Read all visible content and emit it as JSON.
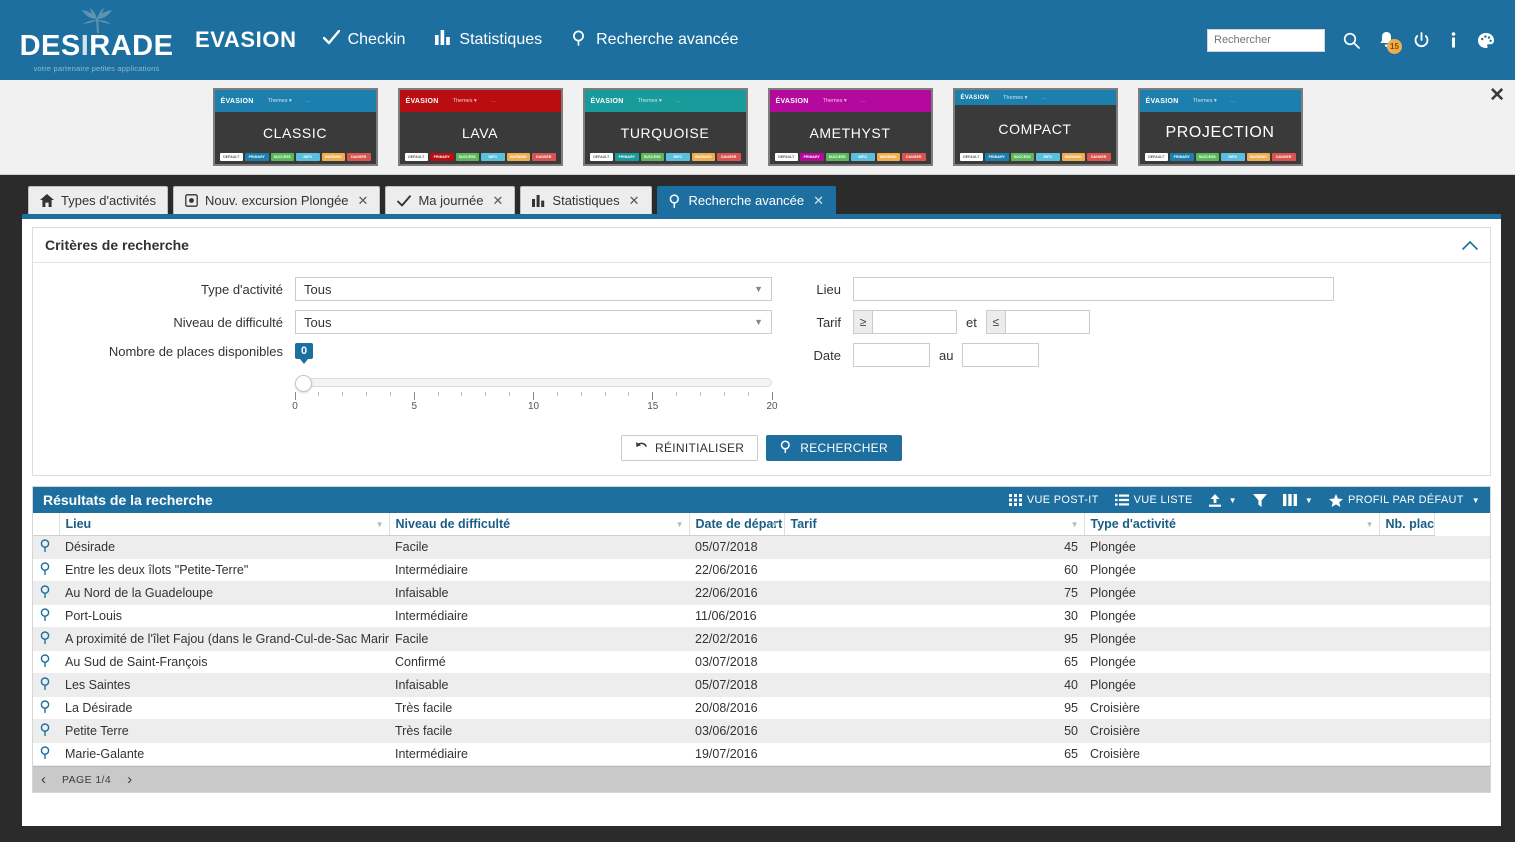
{
  "header": {
    "logo_name_1": "DES",
    "logo_name_2": "I",
    "logo_name_3": "RADE",
    "logo_tagline": "votre partenaire petites applications",
    "brand": "EVASION",
    "nav": [
      {
        "label": "Checkin",
        "icon": "check-icon"
      },
      {
        "label": "Statistiques",
        "icon": "bar-chart-icon"
      },
      {
        "label": "Recherche avancée",
        "icon": "magnifier-icon"
      }
    ],
    "search_placeholder": "Rechercher",
    "search_value": "",
    "notification_count": "15",
    "icons": [
      "search-icon",
      "bell-icon",
      "power-icon",
      "info-icon",
      "palette-icon"
    ]
  },
  "theme_strip": {
    "close_label": "✕",
    "card_labels": {
      "evasion": "ÉVASION",
      "themes": "Themes",
      "dots": "..."
    },
    "swatches": [
      "DEFAULT",
      "PRIMARY",
      "SUCCESS",
      "INFO",
      "WARNING",
      "DANGER"
    ],
    "cards": [
      {
        "name": "CLASSIC",
        "primary": "#1d7fae",
        "variant": "normal"
      },
      {
        "name": "LAVA",
        "primary": "#b90d12",
        "variant": "normal"
      },
      {
        "name": "TURQUOISE",
        "primary": "#1a9b9b",
        "variant": "normal"
      },
      {
        "name": "AMETHYST",
        "primary": "#b5089c",
        "variant": "normal"
      },
      {
        "name": "COMPACT",
        "primary": "#1d7fae",
        "variant": "compact"
      },
      {
        "name": "PROJECTION",
        "primary": "#1d7fae",
        "variant": "projection"
      }
    ]
  },
  "tabs": [
    {
      "label": "Types d'activités",
      "icon": "home-icon",
      "closable": false,
      "active": false
    },
    {
      "label": "Nouv. excursion Plongée",
      "icon": "square-icon",
      "closable": true,
      "active": false
    },
    {
      "label": "Ma journée",
      "icon": "check-icon",
      "closable": true,
      "active": false
    },
    {
      "label": "Statistiques",
      "icon": "bar-chart-icon",
      "closable": true,
      "active": false
    },
    {
      "label": "Recherche avancée",
      "icon": "magnifier-icon",
      "closable": true,
      "active": true
    }
  ],
  "criteria": {
    "title": "Critères de recherche",
    "type_activite": {
      "label": "Type d'activité",
      "value": "Tous"
    },
    "niveau": {
      "label": "Niveau de difficulté",
      "value": "Tous"
    },
    "places": {
      "label": "Nombre de places disponibles",
      "value": "0"
    },
    "slider": {
      "min": 0,
      "max": 20,
      "value": 0,
      "tick_labels": [
        "0",
        "5",
        "10",
        "15",
        "20"
      ]
    },
    "lieu": {
      "label": "Lieu",
      "value": "",
      "placeholder": ""
    },
    "tarif": {
      "label": "Tarif",
      "op_min": "≥",
      "op_max": "≤",
      "conj": "et",
      "min": "",
      "max": ""
    },
    "date": {
      "label": "Date",
      "conj": "au",
      "from": "",
      "to": ""
    },
    "reset_button": "RÉINITIALISER",
    "search_button": "RECHERCHER"
  },
  "results": {
    "title": "Résultats de la recherche",
    "tools": [
      {
        "label": "VUE POST-IT",
        "icon": "grid-icon",
        "caret": false
      },
      {
        "label": "VUE LISTE",
        "icon": "list-icon",
        "caret": false
      },
      {
        "label": "",
        "icon": "export-icon",
        "caret": true
      },
      {
        "label": "",
        "icon": "filter-icon",
        "caret": false
      },
      {
        "label": "",
        "icon": "columns-icon",
        "caret": true
      },
      {
        "label": "PROFIL PAR DÉFAUT",
        "icon": "star-icon",
        "caret": true
      }
    ],
    "columns": [
      "Lieu",
      "Niveau de difficulté",
      "Date de départ",
      "Tarif",
      "Type d'activité",
      "Nb. places dispo"
    ],
    "rows": [
      {
        "lieu": "Désirade",
        "niveau": "Facile",
        "date": "05/07/2018",
        "tarif": "45",
        "type": "Plongée",
        "places": ""
      },
      {
        "lieu": "Entre les deux îlots \"Petite-Terre\"",
        "niveau": "Intermédiaire",
        "date": "22/06/2016",
        "tarif": "60",
        "type": "Plongée",
        "places": ""
      },
      {
        "lieu": "Au Nord de la Guadeloupe",
        "niveau": "Infaisable",
        "date": "22/06/2016",
        "tarif": "75",
        "type": "Plongée",
        "places": ""
      },
      {
        "lieu": "Port-Louis",
        "niveau": "Intermédiaire",
        "date": "11/06/2016",
        "tarif": "30",
        "type": "Plongée",
        "places": ""
      },
      {
        "lieu": "A proximité de l'îlet Fajou (dans le Grand-Cul-de-Sac Marin)",
        "niveau": "Facile",
        "date": "22/02/2016",
        "tarif": "95",
        "type": "Plongée",
        "places": ""
      },
      {
        "lieu": "Au Sud de Saint-François",
        "niveau": "Confirmé",
        "date": "03/07/2018",
        "tarif": "65",
        "type": "Plongée",
        "places": ""
      },
      {
        "lieu": "Les Saintes",
        "niveau": "Infaisable",
        "date": "05/07/2018",
        "tarif": "40",
        "type": "Plongée",
        "places": ""
      },
      {
        "lieu": "La Désirade",
        "niveau": "Très facile",
        "date": "20/08/2016",
        "tarif": "95",
        "type": "Croisière",
        "places": ""
      },
      {
        "lieu": "Petite Terre",
        "niveau": "Très facile",
        "date": "03/06/2016",
        "tarif": "50",
        "type": "Croisière",
        "places": ""
      },
      {
        "lieu": "Marie-Galante",
        "niveau": "Intermédiaire",
        "date": "19/07/2016",
        "tarif": "65",
        "type": "Croisière",
        "places": ""
      }
    ],
    "pager": {
      "prev": "‹",
      "label": "PAGE 1/4",
      "next": "›"
    }
  },
  "colors": {
    "brand_blue": "#1d6fa0",
    "page_dark": "#2b2b2b",
    "success": "#5cb85c",
    "info": "#5bc0de",
    "warning": "#f0ad4e",
    "danger": "#d9534f"
  }
}
